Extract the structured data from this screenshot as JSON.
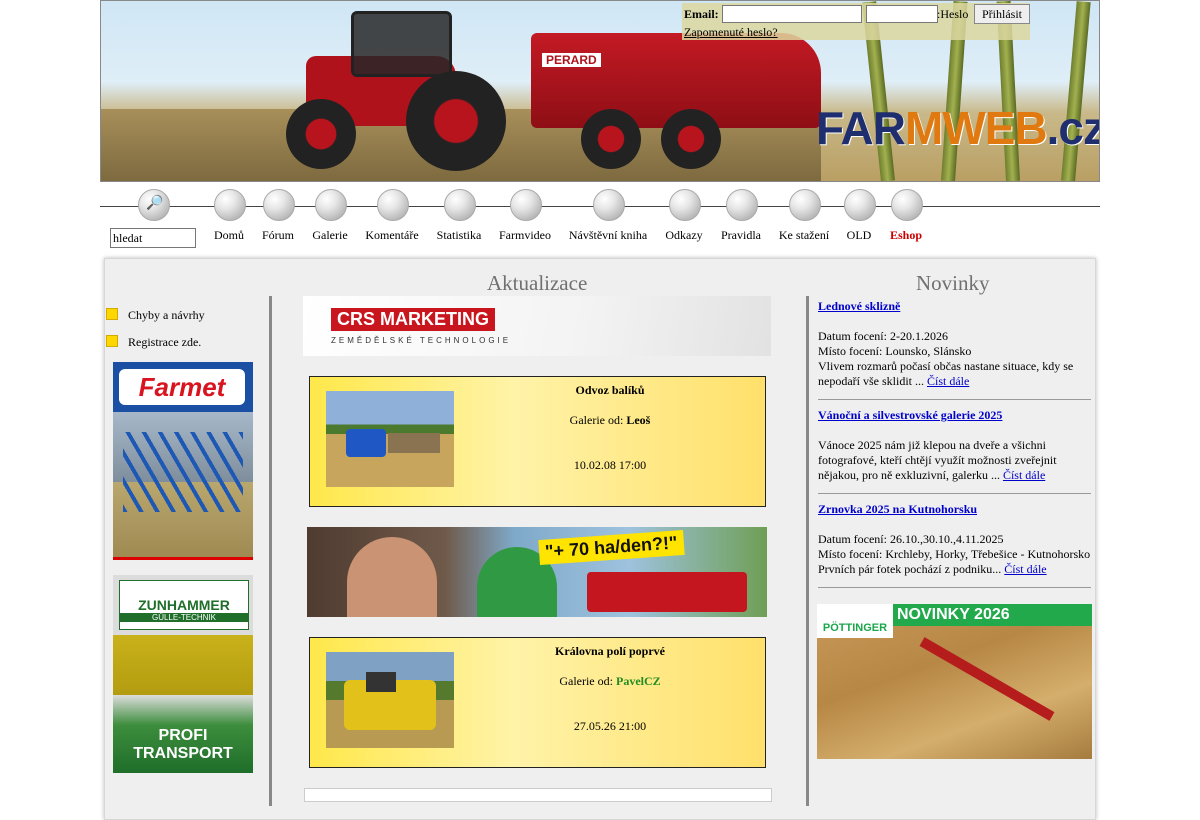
{
  "header": {
    "logo_text_a": "FAR",
    "logo_text_b": "MWEB",
    "logo_text_c": ".cz",
    "trailer_brand": "PERARD"
  },
  "login": {
    "email_label": "Email:",
    "password_label": ":Heslo",
    "submit_label": "Přihlásit",
    "forgot_label": "Zapomenuté heslo?"
  },
  "nav": {
    "search_value": "hledat",
    "items": [
      "Domů",
      "Fórum",
      "Galerie",
      "Komentáře",
      "Statistika",
      "Farmvideo",
      "Návštěvní kniha",
      "Odkazy",
      "Pravidla",
      "Ke stažení",
      "OLD",
      "Eshop"
    ],
    "eshop_color": "#cc0000"
  },
  "sections": {
    "middle_title": "Aktualizace",
    "right_title": "Novinky"
  },
  "left": {
    "links": [
      "Chyby a návrhy",
      "Registrace zde."
    ],
    "ad1_brand": "Farmet",
    "ad2_brand": "ZUNHAMMER",
    "ad2_sub": "GÜLLE-TECHNIK",
    "ad2_caption_a": "PROFI",
    "ad2_caption_b": "TRANSPORT"
  },
  "middle": {
    "crs_logo": "CRS MARKETING",
    "crs_sub": "ZEMĚDĚLSKÉ TECHNOLOGIE",
    "promo_text": "\"+ 70 ha/den?!\"",
    "cards": [
      {
        "title": "Odvoz balíků",
        "by_label": "Galerie od:",
        "author": "Leoš",
        "author_color": "#000000",
        "date": "10.02.08 17:00"
      },
      {
        "title": "Královna polí poprvé",
        "by_label": "Galerie od:",
        "author": "PavelCZ",
        "author_color": "#228b22",
        "date": "27.05.26 21:00"
      }
    ]
  },
  "news": [
    {
      "title": "Lednové sklizně",
      "lines": [
        "Datum focení: 2-20.1.2026",
        "Místo focení: Lounsko, Slánsko",
        "Vlivem rozmarů počasí občas nastane situace, kdy se nepodaří vše sklidit ..."
      ],
      "more": "Číst dále"
    },
    {
      "title": "Vánoční a silvestrovské galerie 2025",
      "lines": [
        "Vánoce 2025 nám již klepou na dveře a všichni fotografové, kteří chtějí využít možnosti zveřejnit nějakou, pro ně exkluzivní, galerku ..."
      ],
      "more": "Číst dále"
    },
    {
      "title": "Zrnovka 2025 na Kutnohorsku",
      "lines": [
        "Datum focení: 26.10.,30.10.,4.11.2025",
        "Místo focení: Krchleby, Horky, Třebešice - Kutnohorsko",
        "Prvních pár fotek pochází z podniku..."
      ],
      "more": "Číst dále"
    }
  ],
  "right_ad": {
    "brand": "PÖTTINGER",
    "headline": "NOVINKY 2026"
  }
}
